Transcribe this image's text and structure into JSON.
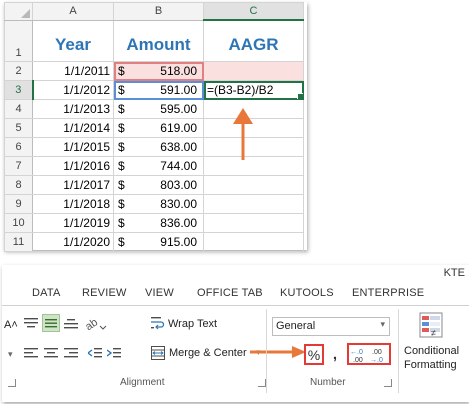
{
  "sheet": {
    "columns": [
      "A",
      "B",
      "C"
    ],
    "header_row": {
      "row": "1",
      "year": "Year",
      "amount": "Amount",
      "aagr": "AAGR"
    },
    "currency_symbol": "$",
    "rows": [
      {
        "row": "2",
        "date": "1/1/2011",
        "amount": "518.00",
        "formula": ""
      },
      {
        "row": "3",
        "date": "1/1/2012",
        "amount": "591.00",
        "formula": "=(B3-B2)/B2"
      },
      {
        "row": "4",
        "date": "1/1/2013",
        "amount": "595.00",
        "formula": ""
      },
      {
        "row": "5",
        "date": "1/1/2014",
        "amount": "619.00",
        "formula": ""
      },
      {
        "row": "6",
        "date": "1/1/2015",
        "amount": "638.00",
        "formula": ""
      },
      {
        "row": "7",
        "date": "1/1/2016",
        "amount": "744.00",
        "formula": ""
      },
      {
        "row": "8",
        "date": "1/1/2017",
        "amount": "803.00",
        "formula": ""
      },
      {
        "row": "9",
        "date": "1/1/2018",
        "amount": "830.00",
        "formula": ""
      },
      {
        "row": "10",
        "date": "1/1/2019",
        "amount": "836.00",
        "formula": ""
      },
      {
        "row": "11",
        "date": "1/1/2020",
        "amount": "915.00",
        "formula": ""
      }
    ]
  },
  "ribbon": {
    "title_partial": "KTE",
    "tabs": [
      "DATA",
      "REVIEW",
      "VIEW",
      "OFFICE TAB",
      "KUTOOLS",
      "ENTERPRISE"
    ],
    "wrap_text_label": "Wrap Text",
    "merge_center_label": "Merge & Center",
    "number_format_value": "General",
    "percent_symbol": "%",
    "comma_symbol": ",",
    "increase_decimal_label": "←.0 .00",
    "decrease_decimal_label": ".00 →.0",
    "conditional_label_line1": "Conditional",
    "conditional_label_line2": "Formatting",
    "groups": {
      "alignment": "Alignment",
      "number": "Number"
    }
  },
  "colors": {
    "header_text": "#2e75b6",
    "highlight_fill": "#fbe0e0",
    "annotation": "#e8773a",
    "red_box": "#e53935",
    "selection_green": "#217346"
  },
  "icons": [
    "align-top-icon",
    "align-middle-icon",
    "align-bottom-icon",
    "orientation-icon",
    "align-left-icon",
    "align-center-icon",
    "align-right-icon",
    "decrease-indent-icon",
    "increase-indent-icon",
    "wrap-text-icon",
    "merge-center-icon",
    "percent-style-icon",
    "comma-style-icon",
    "increase-decimal-icon",
    "decrease-decimal-icon",
    "conditional-formatting-icon",
    "dialog-launcher-icon"
  ]
}
